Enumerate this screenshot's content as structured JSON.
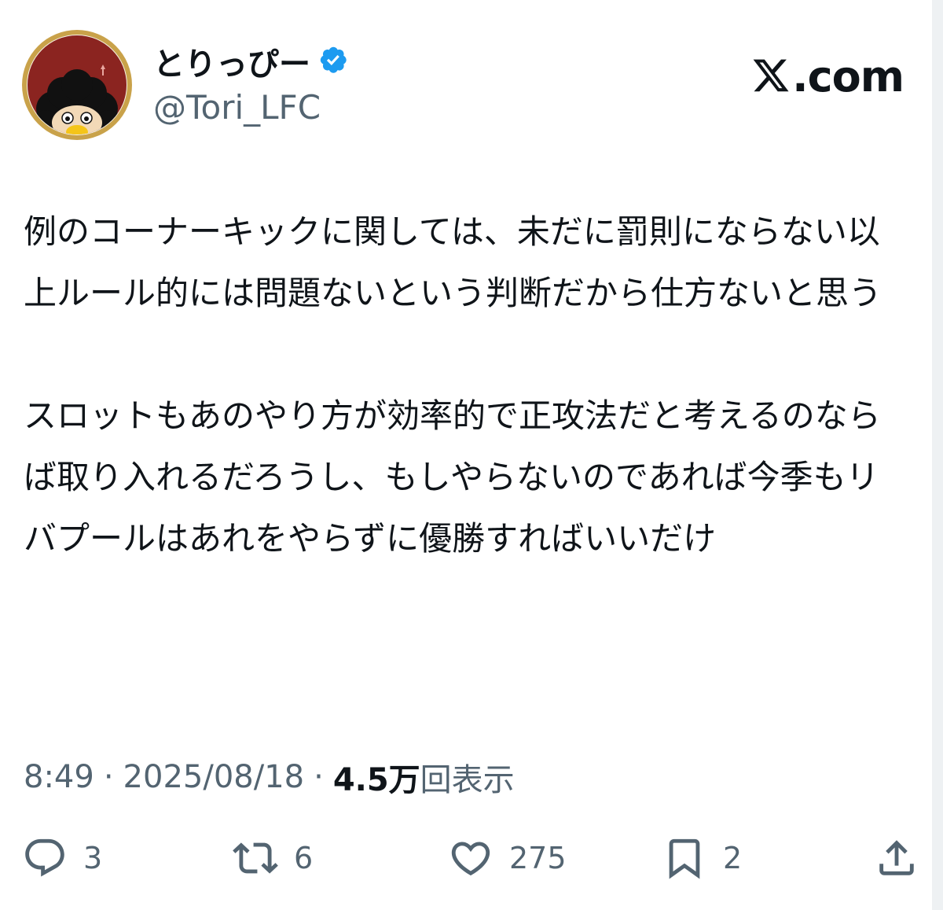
{
  "author": {
    "display_name": "とりっぴー",
    "handle": "@Tori_LFC",
    "verified": true,
    "verified_color": "#1d9bf0"
  },
  "brand": {
    "logo_icon": "x-logo-icon",
    "text": ".com"
  },
  "tweet": {
    "paragraphs": [
      "例のコーナーキックに関しては、未だに罰則にならない以上ルール的には問題ないという判断だから仕方ないと思う",
      "スロットもあのやり方が効率的で正攻法だと考えるのならば取り入れるだろうし、もしやらないのであれば今季もリバプールはあれをやらずに優勝すればいいだけ"
    ]
  },
  "meta": {
    "time": "8:49",
    "separator": "·",
    "date": "2025/08/18",
    "views_count": "4.5万",
    "views_label": "回表示"
  },
  "actions": {
    "reply": {
      "icon": "reply-icon",
      "count": "3"
    },
    "repost": {
      "icon": "repost-icon",
      "count": "6"
    },
    "like": {
      "icon": "heart-icon",
      "count": "275"
    },
    "bookmark": {
      "icon": "bookmark-icon",
      "count": "2"
    },
    "share": {
      "icon": "share-icon"
    }
  },
  "colors": {
    "text_primary": "#0f1419",
    "text_secondary": "#536471",
    "avatar_ring": "#c9a24a",
    "avatar_background": "#8b2420"
  }
}
